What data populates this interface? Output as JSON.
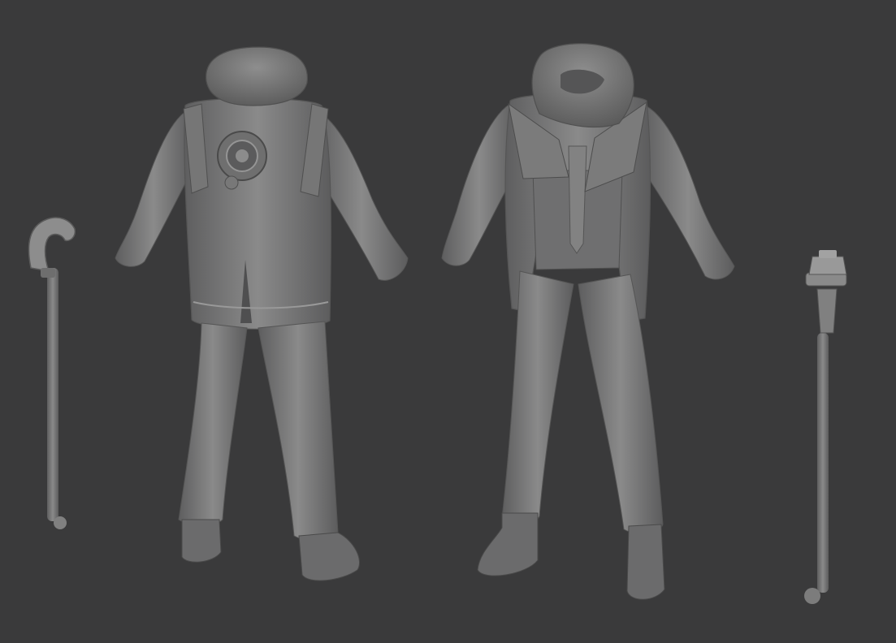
{
  "scene": {
    "background": "#3a3a3b",
    "material": "#7c7c7c",
    "material_dark": "#4f4f50",
    "material_light": "#a3a3a3"
  },
  "objects": [
    {
      "name": "cane-left",
      "icon": "cane-icon"
    },
    {
      "name": "outfit-back-view",
      "icon": "outfit-icon"
    },
    {
      "name": "outfit-front-view",
      "icon": "outfit-icon"
    },
    {
      "name": "cane-right",
      "icon": "cane-icon"
    }
  ]
}
